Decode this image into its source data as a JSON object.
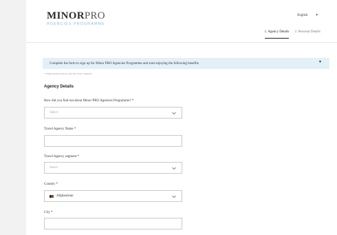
{
  "header": {
    "logo_main_bold": "MINOR",
    "logo_main_rest": "PRO",
    "logo_sub": "AGENCIES PROGRAMME",
    "language": "English",
    "language_caret": "▾"
  },
  "steps": [
    {
      "label": "1. Agency Details",
      "active": true
    },
    {
      "label": "2. Personal Details",
      "active": false
    }
  ],
  "banner": {
    "text": "Complete the form to sign up for Minor PRO Agencies Programme and start enjoying the following benefits",
    "toggle": "▼"
  },
  "note": "* Fields marked with an asterisk (*) are required",
  "section_title": "Agency Details",
  "form": {
    "found_label": "How did you find out about Minor PRO Agencies Programme? *",
    "found_value": "Select",
    "name_label": "Travel Agency Name *",
    "name_value": "",
    "segment_label": "Travel Agency segment *",
    "segment_value": "Select",
    "country_label": "Country *",
    "country_value": "Afghanistan",
    "city_label": "City *",
    "city_value": ""
  },
  "colors": {
    "banner_bg": "#e3f1f7",
    "logo_sub": "#8bbcd4"
  }
}
